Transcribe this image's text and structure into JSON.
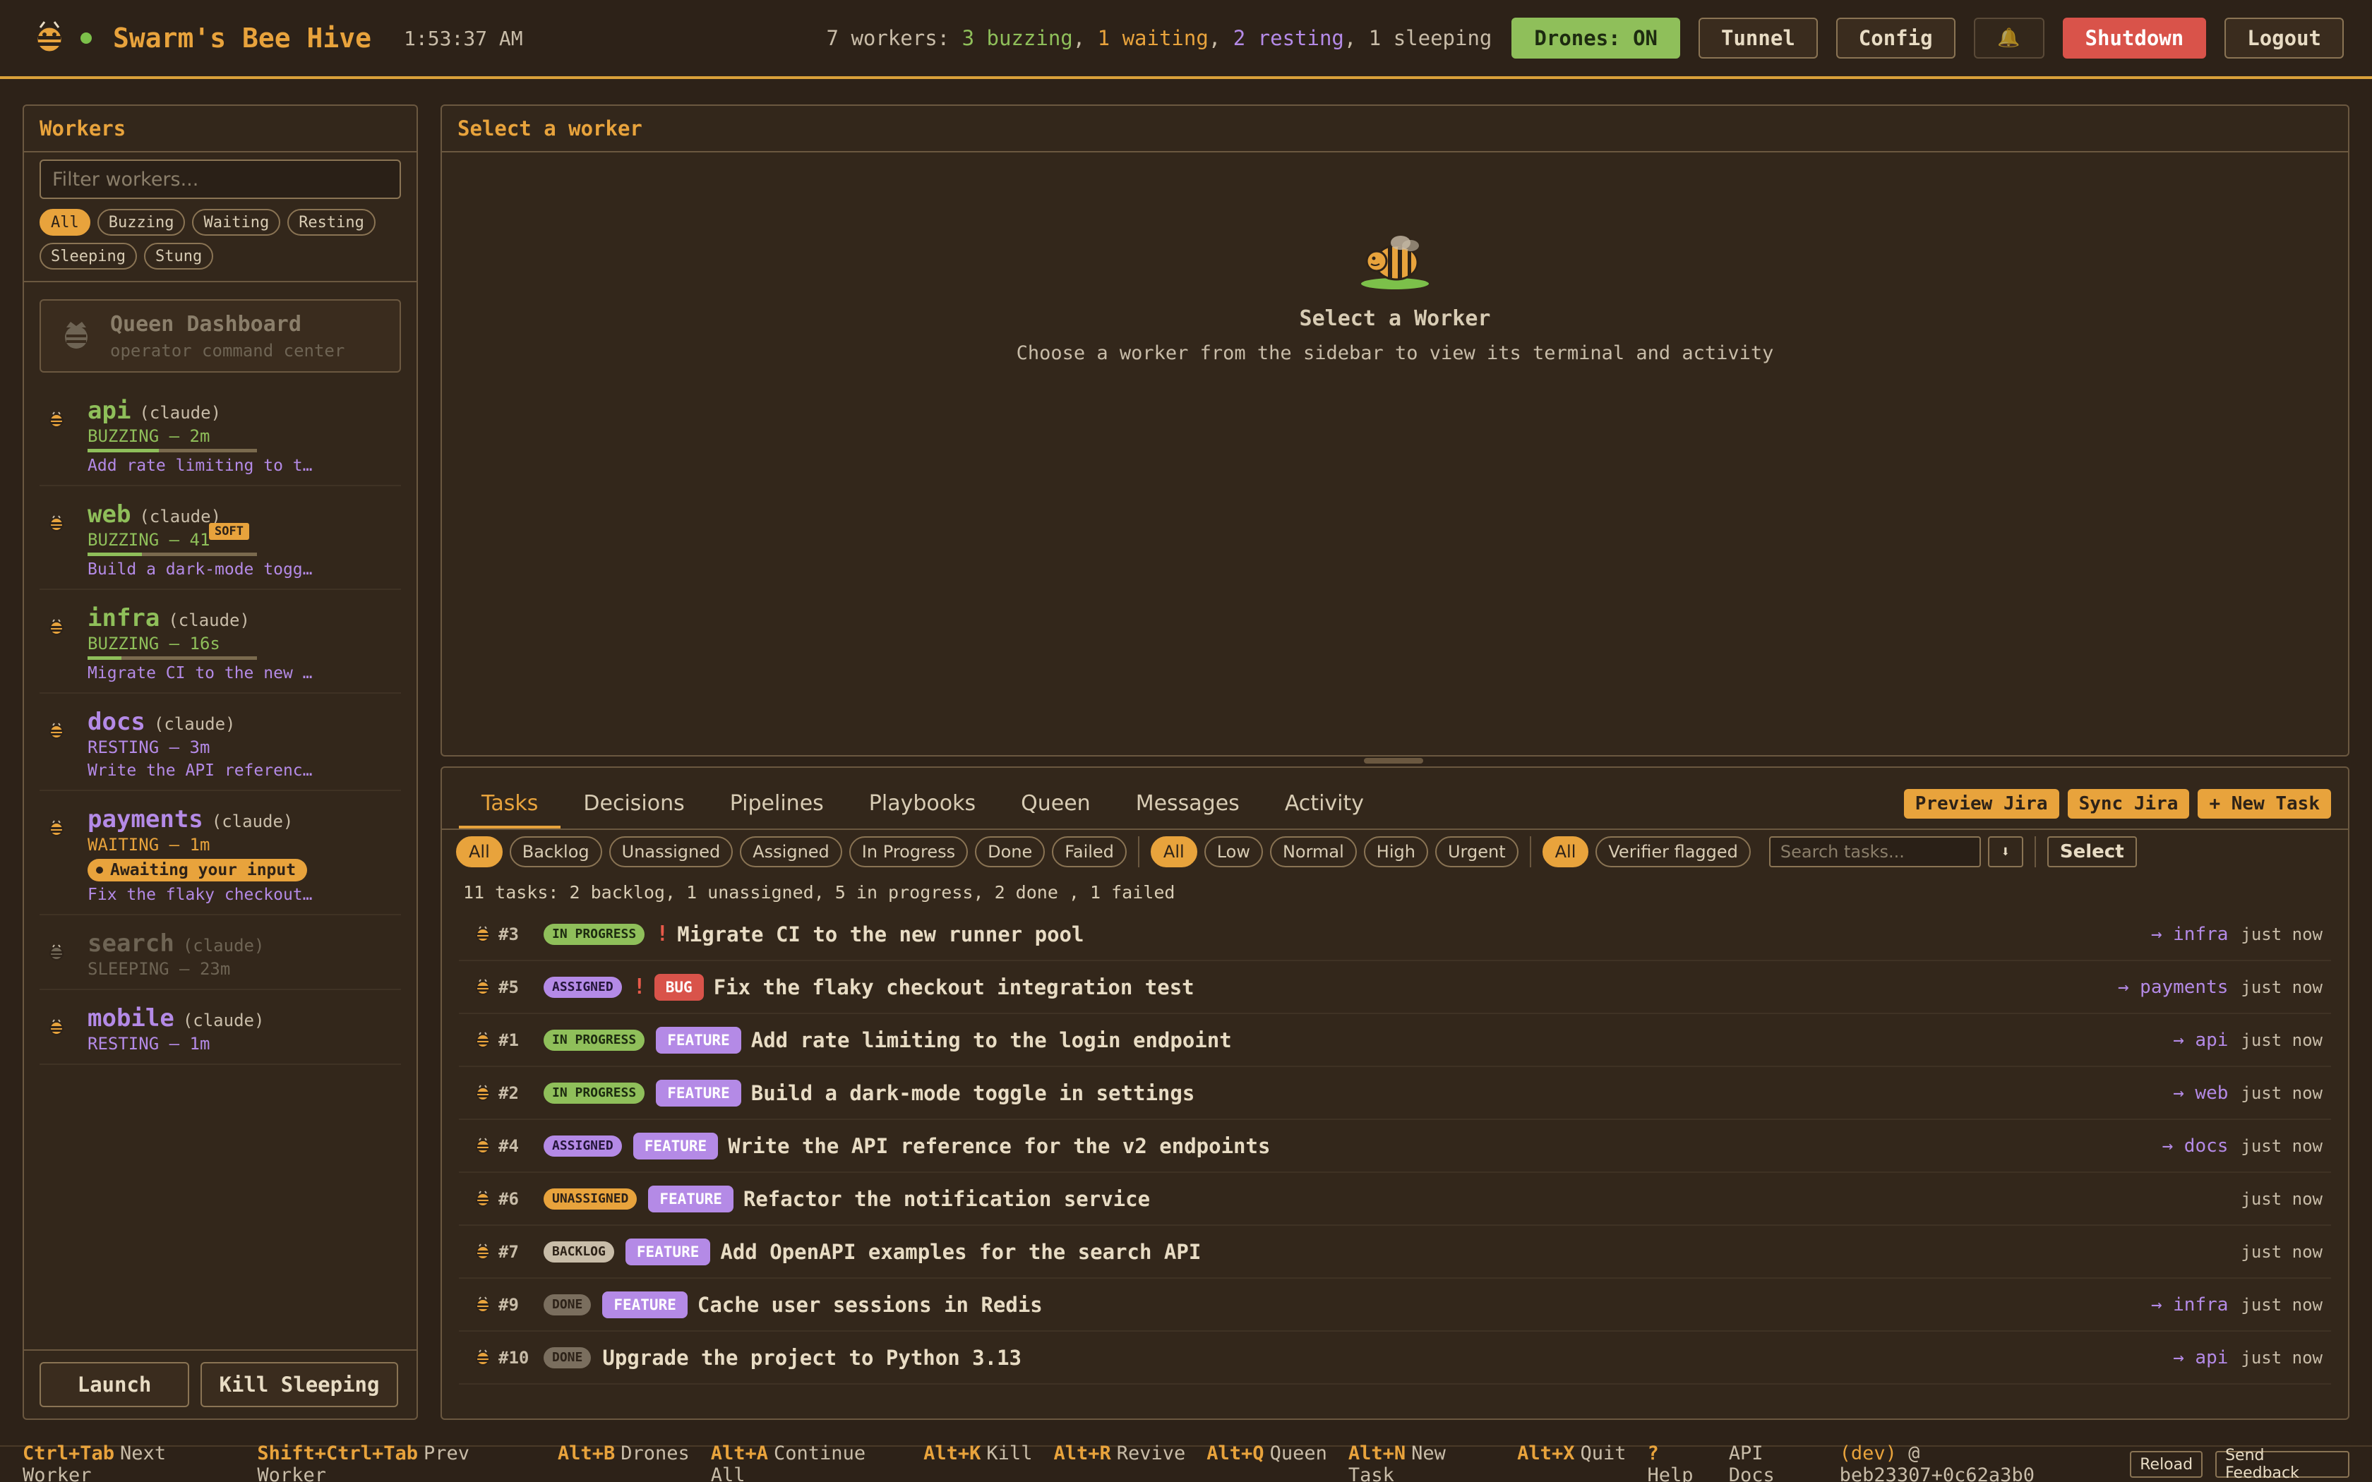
{
  "header": {
    "title": "Swarm's Bee Hive",
    "clock": "1:53:37 AM",
    "summary_prefix": "7 workers: ",
    "summary_buzzing": "3 buzzing",
    "summary_waiting": "1 waiting",
    "summary_resting": "2 resting",
    "summary_sleeping": "1 sleeping",
    "sep": ", ",
    "drones_label": "Drones: ON",
    "tunnel_label": "Tunnel",
    "config_label": "Config",
    "bell_glyph": "🔔",
    "shutdown_label": "Shutdown",
    "logout_label": "Logout"
  },
  "sidebar": {
    "title": "Workers",
    "filter_placeholder": "Filter workers...",
    "chips": [
      "All",
      "Buzzing",
      "Waiting",
      "Resting",
      "Sleeping",
      "Stung"
    ],
    "queen_title": "Queen Dashboard",
    "queen_sub": "operator command center",
    "workers": [
      {
        "name": "api",
        "model": "(claude)",
        "status": "BUZZING — 2m",
        "task": "Add rate limiting to t…",
        "state": "buzzing",
        "progress": 0.42
      },
      {
        "name": "web",
        "model": "(claude)",
        "status": "BUZZING — 41",
        "badge": "SOFT",
        "task": "Build a dark-mode togg…",
        "state": "buzzing",
        "progress": 0.32
      },
      {
        "name": "infra",
        "model": "(claude)",
        "status": "BUZZING — 16s",
        "task": "Migrate CI to the new …",
        "state": "buzzing",
        "progress": 0.2
      },
      {
        "name": "docs",
        "model": "(claude)",
        "status": "RESTING — 3m",
        "task": "Write the API referenc…",
        "state": "resting"
      },
      {
        "name": "payments",
        "model": "(claude)",
        "status": "WAITING — 1m",
        "await": "Awaiting your input",
        "task": "Fix the flaky checkout…",
        "state": "waiting"
      },
      {
        "name": "search",
        "model": "(claude)",
        "status": "SLEEPING — 23m",
        "state": "sleeping"
      },
      {
        "name": "mobile",
        "model": "(claude)",
        "status": "RESTING — 1m",
        "state": "resting"
      }
    ],
    "launch_label": "Launch",
    "kill_label": "Kill Sleeping"
  },
  "main": {
    "title": "Select a worker",
    "empty_title": "Select a Worker",
    "empty_sub": "Choose a worker from the sidebar to view its terminal and activity"
  },
  "tasks_panel": {
    "tabs": [
      "Tasks",
      "Decisions",
      "Pipelines",
      "Playbooks",
      "Queen",
      "Messages",
      "Activity"
    ],
    "actions": [
      "Preview Jira",
      "Sync Jira",
      "+ New Task"
    ],
    "status_filters": [
      "All",
      "Backlog",
      "Unassigned",
      "Assigned",
      "In Progress",
      "Done",
      "Failed"
    ],
    "priority_filters": [
      "All",
      "Low",
      "Normal",
      "High",
      "Urgent"
    ],
    "verifier_filters": [
      "All",
      "Verifier flagged"
    ],
    "search_placeholder": "Search tasks...",
    "sort_glyph": "⬇",
    "select_label": "Select",
    "summary": "11 tasks: 2 backlog, 1 unassigned, 5 in progress, 2 done , 1 failed",
    "tasks": [
      {
        "num": "#3",
        "status": "IN PROGRESS",
        "cls": "s-inprogress",
        "prio": "!",
        "type": "",
        "title": "Migrate CI to the new runner pool",
        "assignee": "→ infra",
        "time": "just now"
      },
      {
        "num": "#5",
        "status": "ASSIGNED",
        "cls": "s-assigned",
        "prio": "!",
        "type": "BUG",
        "title": "Fix the flaky checkout integration test",
        "assignee": "→ payments",
        "time": "just now"
      },
      {
        "num": "#1",
        "status": "IN PROGRESS",
        "cls": "s-inprogress",
        "prio": "",
        "type": "FEATURE",
        "title": "Add rate limiting to the login endpoint",
        "assignee": "→ api",
        "time": "just now"
      },
      {
        "num": "#2",
        "status": "IN PROGRESS",
        "cls": "s-inprogress",
        "prio": "",
        "type": "FEATURE",
        "title": "Build a dark-mode toggle in settings",
        "assignee": "→ web",
        "time": "just now"
      },
      {
        "num": "#4",
        "status": "ASSIGNED",
        "cls": "s-assigned",
        "prio": "",
        "type": "FEATURE",
        "title": "Write the API reference for the v2 endpoints",
        "assignee": "→ docs",
        "time": "just now"
      },
      {
        "num": "#6",
        "status": "UNASSIGNED",
        "cls": "s-unassigned",
        "prio": "",
        "type": "FEATURE",
        "title": "Refactor the notification service",
        "assignee": "",
        "time": "just now"
      },
      {
        "num": "#7",
        "status": "BACKLOG",
        "cls": "s-backlog",
        "prio": "",
        "type": "FEATURE",
        "title": "Add OpenAPI examples for the search API",
        "assignee": "",
        "time": "just now"
      },
      {
        "num": "#9",
        "status": "DONE",
        "cls": "s-done",
        "prio": "",
        "type": "FEATURE",
        "title": "Cache user sessions in Redis",
        "assignee": "→ infra",
        "time": "just now"
      },
      {
        "num": "#10",
        "status": "DONE",
        "cls": "s-done",
        "prio": "",
        "type": "",
        "title": "Upgrade the project to Python 3.13",
        "assignee": "→ api",
        "time": "just now"
      }
    ]
  },
  "footer": {
    "shortcuts": [
      {
        "key": "Ctrl+Tab",
        "label": "Next Worker"
      },
      {
        "key": "Shift+Ctrl+Tab",
        "label": "Prev Worker"
      },
      {
        "key": "Alt+B",
        "label": "Drones"
      },
      {
        "key": "Alt+A",
        "label": "Continue All"
      },
      {
        "key": "Alt+K",
        "label": "Kill"
      },
      {
        "key": "Alt+R",
        "label": "Revive"
      },
      {
        "key": "Alt+Q",
        "label": "Queen"
      },
      {
        "key": "Alt+N",
        "label": "New Task"
      },
      {
        "key": "Alt+X",
        "label": "Quit"
      },
      {
        "key": "?",
        "label": "Help"
      }
    ],
    "api_docs": "API Docs",
    "version_tag": "(dev)",
    "version": "@ beb23307+0c62a3b0",
    "reload_label": "Reload",
    "feedback_label": "Send Feedback"
  },
  "colors": {
    "accent": "#e8a33c",
    "buzzing": "#8fbf5a",
    "resting": "#b48ae6",
    "danger": "#d9534a",
    "background": "#2d2218"
  }
}
